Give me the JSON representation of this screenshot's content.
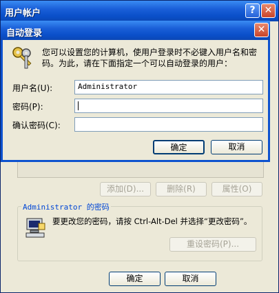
{
  "back_window": {
    "title": "用户帐户",
    "help_label": "?",
    "close_label": "✕",
    "buttons": {
      "add": "添加(D)...",
      "remove": "删除(R)",
      "properties": "属性(O)"
    },
    "password_group": {
      "legend": "Administrator 的密码",
      "message": "要更改您的密码，请按 Ctrl-Alt-Del 并选择“更改密码”。",
      "reset_button": "重设密码(P)..."
    },
    "ok_label": "确定",
    "cancel_label": "取消"
  },
  "dialog": {
    "title": "自动登录",
    "close_label": "✕",
    "intro": "您可以设置您的计算机，使用户登录时不必键入用户名和密码。为此，请在下面指定一个可以自动登录的用户：",
    "username_label": "用户名(U):",
    "username_value": "Administrator",
    "password_label": "密码(P):",
    "confirm_label": "确认密码(C):",
    "ok_label": "确定",
    "cancel_label": "取消"
  },
  "colors": {
    "title_blue": "#0b4fc9",
    "face": "#ece9d8",
    "legend_blue": "#0046d5",
    "close_red": "#c8442a"
  }
}
